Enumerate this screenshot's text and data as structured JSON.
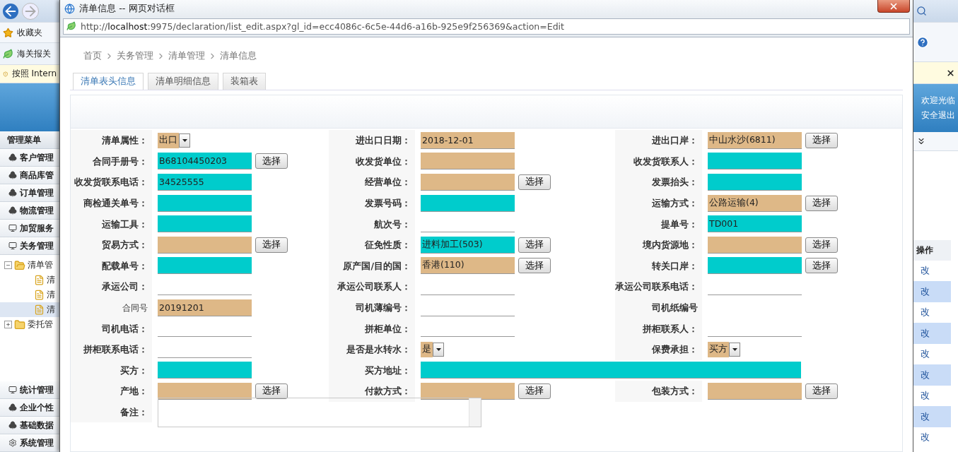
{
  "background_window": {
    "left": {
      "favorites": "收藏夹",
      "tab": "海关报关",
      "info_bar": "按照 Intern",
      "menu_title": "管理菜单",
      "menu_items": [
        {
          "label": "客户管理",
          "kind": "club"
        },
        {
          "label": "商品库管",
          "kind": "club"
        },
        {
          "label": "订单管理",
          "kind": "club"
        },
        {
          "label": "物流管理",
          "kind": "club"
        },
        {
          "label": "加贸服务",
          "kind": "monitor"
        },
        {
          "label": "关务管理",
          "kind": "monitor"
        }
      ],
      "tree": [
        {
          "label": "清单管",
          "expanded": true,
          "children": [
            {
              "label": "清",
              "selected": false
            },
            {
              "label": "清",
              "selected": false
            },
            {
              "label": "清",
              "selected": true
            }
          ]
        },
        {
          "label": "委托管",
          "expanded": false
        }
      ],
      "bottom_items": [
        {
          "label": "统计管理",
          "kind": "monitor"
        },
        {
          "label": "企业个性",
          "kind": "club"
        },
        {
          "label": "基础数据",
          "kind": "club"
        },
        {
          "label": "系统管理",
          "kind": "gear"
        }
      ]
    },
    "right": {
      "welcome": "欢迎光临",
      "logout": "安全退出",
      "table_header": "操作",
      "rows": [
        "改",
        "改",
        "改",
        "改",
        "改",
        "改",
        "改",
        "改",
        "改"
      ]
    }
  },
  "dialog": {
    "title": "清单信息 -- 网页对话框",
    "url": "http://**localhost**:9975/declaration/list_edit.aspx?gl_id=ecc4086c-6c5e-44d6-a16b-925e9f256369&action=Edit",
    "breadcrumb": [
      "首页",
      "关务管理",
      "清单管理",
      "清单信息"
    ],
    "tabs": [
      {
        "label": "清单表头信息",
        "selected": true
      },
      {
        "label": "清单明细信息",
        "selected": false
      },
      {
        "label": "装箱表",
        "selected": false
      }
    ],
    "form": {
      "rows": [
        {
          "cells": [
            {
              "label": "清单属性：",
              "bold": true,
              "kind": "select",
              "value": "出口",
              "color": "#deb887"
            },
            {
              "label": "进出口日期：",
              "bold": true,
              "kind": "input",
              "value": "2018-12-01",
              "color": "#deb887"
            },
            {
              "label": "进出口岸：",
              "bold": true,
              "kind": "input",
              "value": "中山水沙(6811)",
              "color": "#deb887",
              "button": "选择"
            }
          ]
        },
        {
          "cells": [
            {
              "label": "合同手册号：",
              "bold": true,
              "kind": "input",
              "value": "B68104450203",
              "color": "#00cccc",
              "button": "选择"
            },
            {
              "label": "收发货单位：",
              "bold": true,
              "kind": "input",
              "color": "#deb887"
            },
            {
              "label": "收发货联系人：",
              "bold": true,
              "kind": "input",
              "color": "#00cccc"
            }
          ]
        },
        {
          "cells": [
            {
              "label": "收发货联系电话：",
              "bold": true,
              "kind": "input",
              "value": "34525555",
              "color": "#00cccc"
            },
            {
              "label": "经营单位：",
              "bold": true,
              "kind": "input",
              "color": "#deb887",
              "button": "选择"
            },
            {
              "label": "发票抬头：",
              "bold": true,
              "kind": "input",
              "color": "#00cccc"
            }
          ]
        },
        {
          "cells": [
            {
              "label": "商检通关单号：",
              "bold": true,
              "kind": "input",
              "color": "#00cccc"
            },
            {
              "label": "发票号码：",
              "bold": true,
              "kind": "input",
              "color": "#00cccc"
            },
            {
              "label": "运输方式：",
              "bold": true,
              "kind": "input",
              "value": "公路运输(4)",
              "color": "#deb887",
              "button": "选择"
            }
          ]
        },
        {
          "cells": [
            {
              "label": "运输工具：",
              "bold": true,
              "kind": "input",
              "color": "#00cccc"
            },
            {
              "label": "航次号：",
              "bold": true,
              "kind": "line"
            },
            {
              "label": "提单号：",
              "bold": true,
              "kind": "input",
              "value": "TD001",
              "color": "#00cccc"
            }
          ]
        },
        {
          "cells": [
            {
              "label": "贸易方式：",
              "bold": true,
              "kind": "input",
              "color": "#deb887",
              "button": "选择"
            },
            {
              "label": "征免性质：",
              "bold": true,
              "kind": "input",
              "value": "进料加工(503)",
              "color": "#00cccc",
              "button": "选择"
            },
            {
              "label": "境内货源地：",
              "bold": true,
              "kind": "input",
              "color": "#deb887",
              "button": "选择"
            }
          ]
        },
        {
          "cells": [
            {
              "label": "配载单号：",
              "bold": true,
              "kind": "input",
              "color": "#00cccc"
            },
            {
              "label": "原产国/目的国：",
              "bold": true,
              "kind": "input",
              "value": "香港(110)",
              "color": "#deb887",
              "button": "选择"
            },
            {
              "label": "转关口岸：",
              "bold": true,
              "kind": "input",
              "color": "#00cccc",
              "button": "选择"
            }
          ]
        },
        {
          "cells": [
            {
              "label": "承运公司：",
              "bold": true,
              "kind": "line"
            },
            {
              "label": "承运公司联系人：",
              "bold": true,
              "kind": "line"
            },
            {
              "label": "承运公司联系电话：",
              "bold": true,
              "kind": "line"
            }
          ]
        },
        {
          "cells": [
            {
              "label": "合同号",
              "bold": false,
              "kind": "input",
              "value": "20191201",
              "color": "#deb887"
            },
            {
              "label": "司机薄编号：",
              "bold": true,
              "kind": "line"
            },
            {
              "label": "司机纸编号",
              "bold": true,
              "kind": "none"
            }
          ]
        },
        {
          "cells": [
            {
              "label": "司机电话：",
              "bold": true,
              "kind": "line"
            },
            {
              "label": "拼柜单位：",
              "bold": true,
              "kind": "line"
            },
            {
              "label": "拼柜联系人：",
              "bold": true,
              "kind": "line"
            }
          ]
        },
        {
          "cells": [
            {
              "label": "拼柜联系电话：",
              "bold": true,
              "kind": "line"
            },
            {
              "label": "是否是水转水：",
              "bold": true,
              "kind": "select",
              "value": "是",
              "color": "#deb887"
            },
            {
              "label": "保费承担：",
              "bold": true,
              "kind": "select",
              "value": "买方",
              "color": "#deb887"
            }
          ]
        },
        {
          "cells": [
            {
              "label": "买方：",
              "bold": true,
              "kind": "input",
              "color": "#00cccc"
            },
            {
              "label": "买方地址：",
              "bold": true,
              "kind": "wide",
              "color": "#00cccc"
            }
          ]
        },
        {
          "cells": [
            {
              "label": "产地：",
              "bold": true,
              "kind": "input",
              "color": "#deb887",
              "button": "选择"
            },
            {
              "label": "付款方式：",
              "bold": true,
              "kind": "input",
              "color": "#deb887",
              "button": "选择"
            },
            {
              "label": "包装方式：",
              "bold": true,
              "kind": "input",
              "color": "#deb887",
              "button": "选择"
            }
          ]
        },
        {
          "cells": [
            {
              "label": "备注：",
              "bold": true,
              "kind": "textarea"
            }
          ]
        }
      ]
    }
  }
}
